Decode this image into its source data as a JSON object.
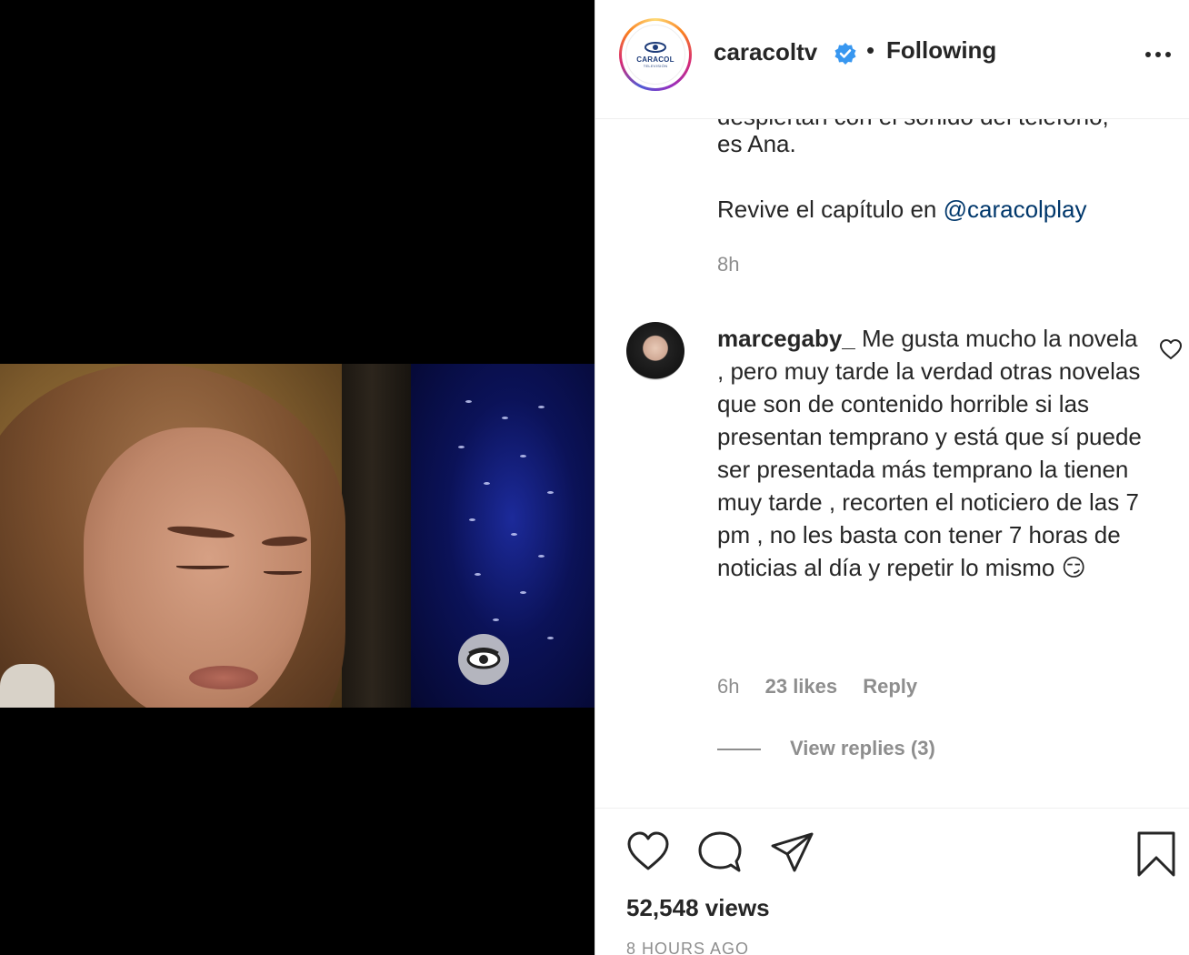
{
  "media": {
    "watermark_icon": "caracol-eye-icon",
    "colors": {
      "background": "#000000"
    }
  },
  "post_header": {
    "avatar_logo_text": "CARACOL",
    "avatar_logo_subtext": "TELEVISIÓN",
    "username": "caracoltv",
    "verified_icon": "verified-badge-icon",
    "separator": "•",
    "follow_status": "Following",
    "more_icon": "more-options-icon"
  },
  "caption": {
    "partial_line": "despiertan con el sonido del teléfono,",
    "end_line": "es Ana.",
    "revive_text": "Revive el capítulo en ",
    "mention": "@caracolplay",
    "time": "8h"
  },
  "comment": {
    "username": "marcegaby_",
    "text": " Me gusta mucho la novela , pero muy tarde la verdad otras novelas que son de contenido horrible si las presentan temprano y está que sí puede ser presentada más temprano la tienen muy tarde , recorten el noticiero de las 7 pm , no les basta con tener 7 horas de noticias al día y repetir lo mismo 😏",
    "time": "6h",
    "likes": "23 likes",
    "reply_label": "Reply",
    "view_replies": "View replies (3)",
    "like_icon": "heart-outline-icon"
  },
  "actions": {
    "icons": [
      "heart-icon",
      "comment-icon",
      "share-icon",
      "bookmark-icon"
    ],
    "views": "52,548 views",
    "posted_ago": "8 HOURS AGO"
  },
  "colors": {
    "text": "#262626",
    "secondary": "#8e8e8e",
    "link": "#00376b",
    "verified": "#3897f0",
    "divider": "#efefef"
  }
}
